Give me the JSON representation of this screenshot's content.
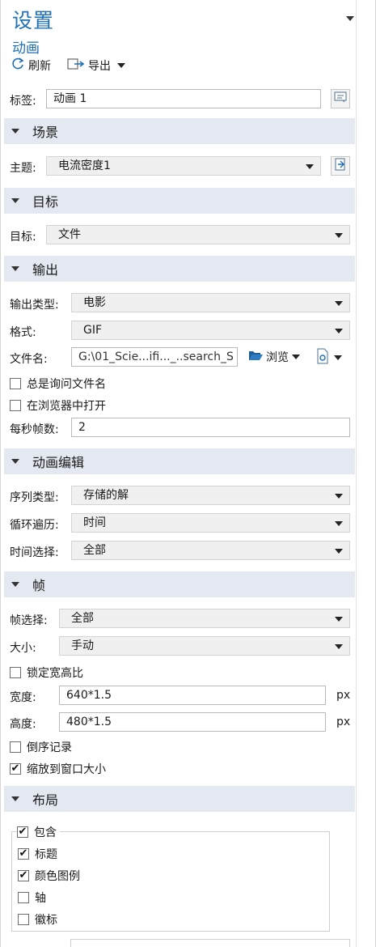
{
  "header": {
    "title": "设置",
    "subtitle": "动画"
  },
  "toolbar": {
    "refresh_label": "刷新",
    "export_label": "导出"
  },
  "label_field": {
    "label": "标签:",
    "value": "动画 1"
  },
  "sections": {
    "scene": "场景",
    "target": "目标",
    "output": "输出",
    "anim_edit": "动画编辑",
    "frames": "帧",
    "layout": "布局"
  },
  "scene": {
    "subject_label": "主题:",
    "subject_value": "电流密度1"
  },
  "target": {
    "target_label": "目标:",
    "target_value": "文件"
  },
  "output": {
    "type_label": "输出类型:",
    "type_value": "电影",
    "format_label": "格式:",
    "format_value": "GIF",
    "filename_label": "文件名:",
    "filename_value": "G:\\01_Scie...ifi..._..search_S",
    "browse_label": "浏览",
    "always_ask_label": "总是询问文件名",
    "open_in_browser_label": "在浏览器中打开",
    "fps_label": "每秒帧数:",
    "fps_value": "2"
  },
  "anim_edit": {
    "seq_label": "序列类型:",
    "seq_value": "存储的解",
    "loop_label": "循环遍历:",
    "loop_value": "时间",
    "time_sel_label": "时间选择:",
    "time_sel_value": "全部"
  },
  "frames": {
    "frame_sel_label": "帧选择:",
    "frame_sel_value": "全部",
    "size_label": "大小:",
    "size_value": "手动",
    "lock_ratio_label": "锁定宽高比",
    "width_label": "宽度:",
    "width_value": "640*1.5",
    "height_label": "高度:",
    "height_value": "480*1.5",
    "unit": "px",
    "reverse_label": "倒序记录",
    "fit_window_label": "缩放到窗口大小",
    "fit_window_checked": true
  },
  "layout": {
    "include_label": "包含",
    "title_label": "标题",
    "color_legend_label": "颜色图例",
    "axis_label": "轴",
    "logo_label": "徽标",
    "include_checked": true,
    "title_checked": true,
    "color_legend_checked": true,
    "axis_checked": false,
    "logo_checked": false
  },
  "colors": {
    "accent": "#1e6fb5",
    "section_bg": "#e3e8f1",
    "combo_bg": "#f0f0f0"
  }
}
